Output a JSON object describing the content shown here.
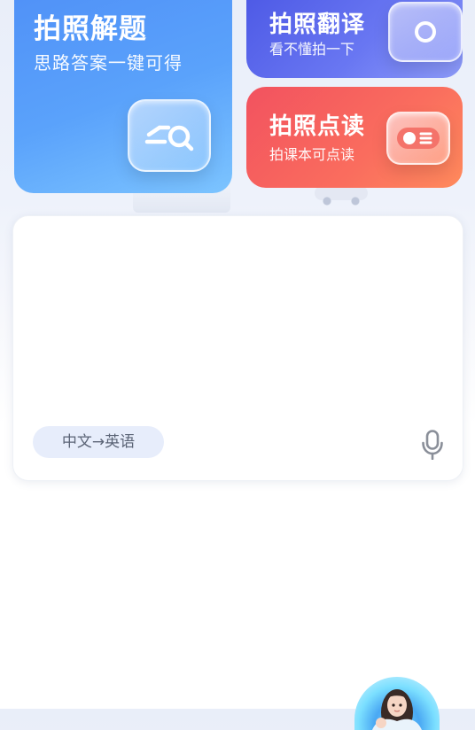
{
  "cards": {
    "solve": {
      "title": "拍照解题",
      "subtitle": "思路答案一键可得",
      "icon": "scan-search-icon",
      "color": "#4f8ff7"
    },
    "translate": {
      "title": "拍照翻译",
      "subtitle": "看不懂拍一下",
      "icon": "camera-icon",
      "color": "#4a56e4"
    },
    "read": {
      "title": "拍照点读",
      "subtitle": "拍课本可点读",
      "icon": "read-toggle-icon",
      "color": "#f2525f"
    }
  },
  "input_panel": {
    "text": "",
    "language_pair": "中文→英语",
    "voice_icon": "microphone-icon"
  },
  "assistant": {
    "icon": "assistant-avatar"
  }
}
